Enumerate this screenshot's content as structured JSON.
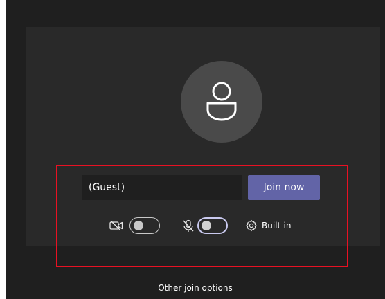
{
  "join": {
    "name_value": "(Guest)",
    "join_button_label": "Join now"
  },
  "devices": {
    "camera_state": "off",
    "microphone_state": "off",
    "device_settings_label": "Built-in"
  },
  "footer": {
    "other_join_options_label": "Other join options"
  },
  "icons": {
    "avatar": "person-icon",
    "camera": "camera-off-icon",
    "microphone": "microphone-off-icon",
    "settings": "gear-icon"
  },
  "colors": {
    "background": "#1f1f1f",
    "card": "#292929",
    "avatar_bg": "#4a4a4a",
    "accent": "#6264a7",
    "highlight_box": "#e81123"
  }
}
